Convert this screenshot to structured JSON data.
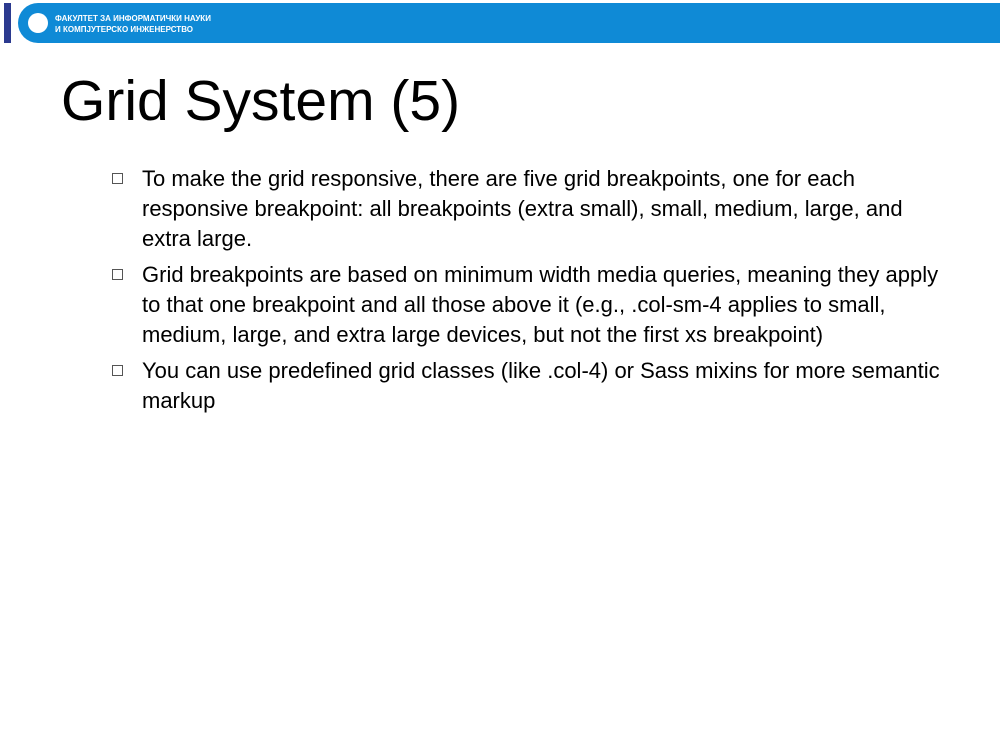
{
  "header": {
    "faculty_line1": "ФАКУЛТЕТ ЗА ИНФОРМАТИЧКИ НАУКИ",
    "faculty_line2": "И КОМПЈУТЕРСКО ИНЖЕНЕРСТВО",
    "band_color": "#0f8ad6",
    "stripe_color": "#2b3a8f"
  },
  "slide": {
    "title": "Grid System (5)",
    "bullets": [
      "To make the grid responsive, there are five grid breakpoints, one for each responsive breakpoint: all breakpoints (extra small), small, medium, large, and extra large.",
      "Grid breakpoints are based on minimum width media queries, meaning they apply to that one breakpoint and all those above it (e.g., .col-sm-4 applies to small, medium, large, and extra large devices, but not the first xs breakpoint)",
      "You can use predefined grid classes (like .col-4) or Sass mixins for more semantic markup"
    ]
  }
}
